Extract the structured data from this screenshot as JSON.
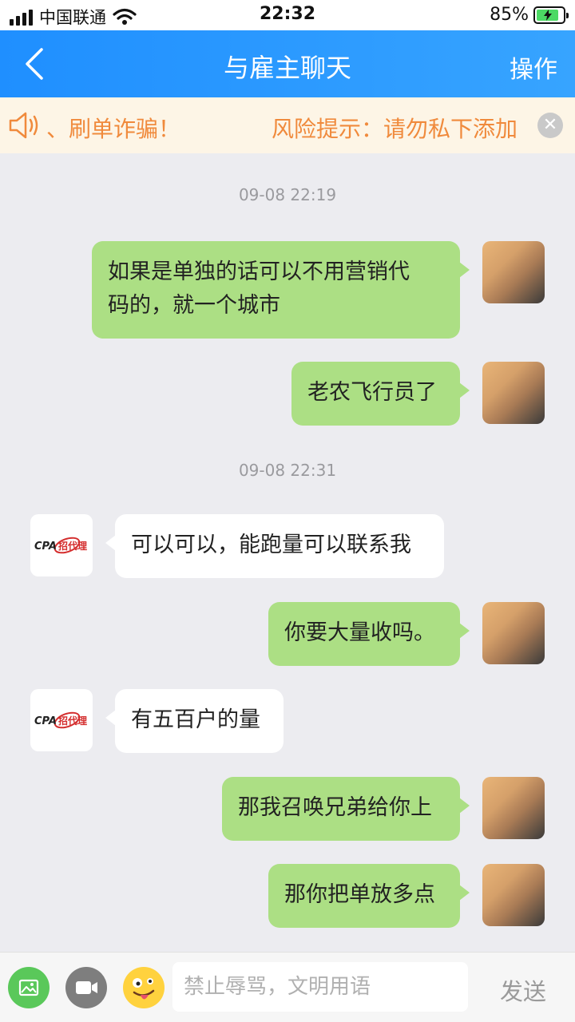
{
  "status_bar": {
    "carrier": "中国联通",
    "time": "22:32",
    "battery": "85%",
    "battery_level": 0.85
  },
  "header": {
    "title": "与雇主聊天",
    "action": "操作"
  },
  "risk_banner": {
    "text_fragment": "、刷单诈骗！",
    "text_main": "风险提示：请勿私下添加"
  },
  "chat": {
    "time_1": "09-08 22:19",
    "time_2": "09-08 22:31",
    "messages": [
      {
        "side": "right",
        "text_line1": "如果是单独的话可以不用营销代",
        "text_line2": "码的，就一个城市"
      },
      {
        "side": "right",
        "text": "老农飞行员了"
      },
      {
        "side": "left",
        "text": "可以可以，能跑量可以联系我"
      },
      {
        "side": "right",
        "text": "你要大量收吗。"
      },
      {
        "side": "left",
        "text": "有五百户的量"
      },
      {
        "side": "right",
        "text": "那我召唤兄弟给你上"
      },
      {
        "side": "right",
        "text": "那你把单放多点"
      }
    ],
    "employer_logo_text": "CPA招代理"
  },
  "input_bar": {
    "placeholder": "禁止辱骂，文明用语",
    "value": "",
    "send": "发送"
  },
  "colors": {
    "header_blue": "#1f8fff",
    "bubble_green": "#acdf84",
    "banner_orange": "#f08a3c",
    "banner_bg": "#fdf5e6"
  }
}
